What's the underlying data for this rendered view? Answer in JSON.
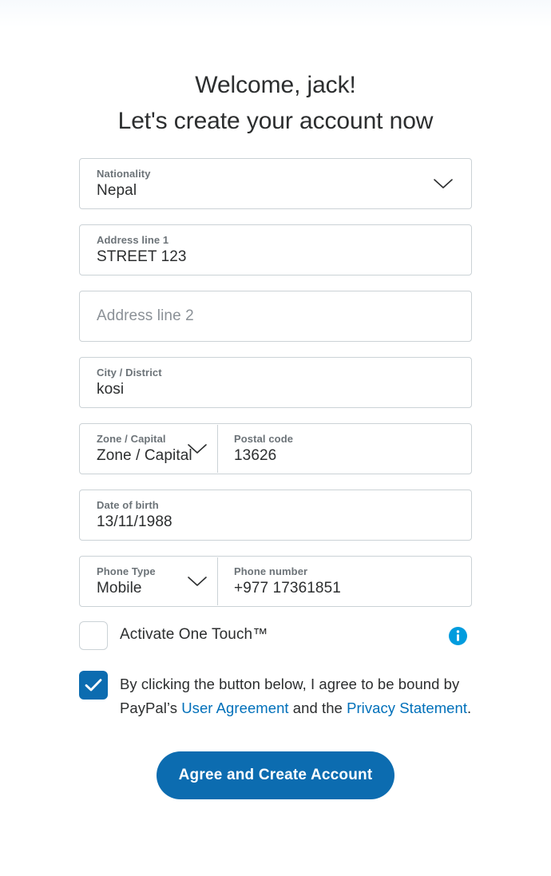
{
  "heading": {
    "line1": "Welcome, jack!",
    "line2": "Let's create your account now"
  },
  "form": {
    "nationality": {
      "label": "Nationality",
      "value": "Nepal",
      "icon": "chevron-down-icon"
    },
    "address_line_1": {
      "label": "Address line 1",
      "value": "STREET 123"
    },
    "address_line_2": {
      "placeholder": "Address line 2",
      "value": ""
    },
    "city_district": {
      "label": "City / District",
      "value": "kosi"
    },
    "zone_capital": {
      "label": "Zone / Capital",
      "value": "Zone / Capital",
      "icon": "chevron-down-icon"
    },
    "postal_code": {
      "label": "Postal code",
      "value": "13626"
    },
    "date_of_birth": {
      "label": "Date of birth",
      "value": "13/11/1988"
    },
    "phone_type": {
      "label": "Phone Type",
      "value": "Mobile",
      "icon": "chevron-down-icon"
    },
    "phone_number": {
      "label": "Phone number",
      "value": "+977  17361851"
    }
  },
  "one_touch": {
    "label": "Activate One Touch™",
    "checked": false,
    "info_icon": "info-circle-icon"
  },
  "agreement": {
    "checked": true,
    "text_part_1": "By clicking the button below, I agree to be bound by PayPal’s ",
    "link_user_agreement": "User Agreement",
    "text_part_2": " and the ",
    "link_privacy_statement": "Privacy Statement",
    "text_part_3": "."
  },
  "submit": {
    "label": "Agree and Create Account"
  },
  "colors": {
    "brand_blue": "#0c6cb0",
    "link_blue": "#0070ba",
    "info_blue": "#009cde",
    "label_gray": "#6c7378",
    "border_gray": "#cbd2d6",
    "text_dark": "#2c2e2f",
    "placeholder_gray": "#8b9197"
  }
}
